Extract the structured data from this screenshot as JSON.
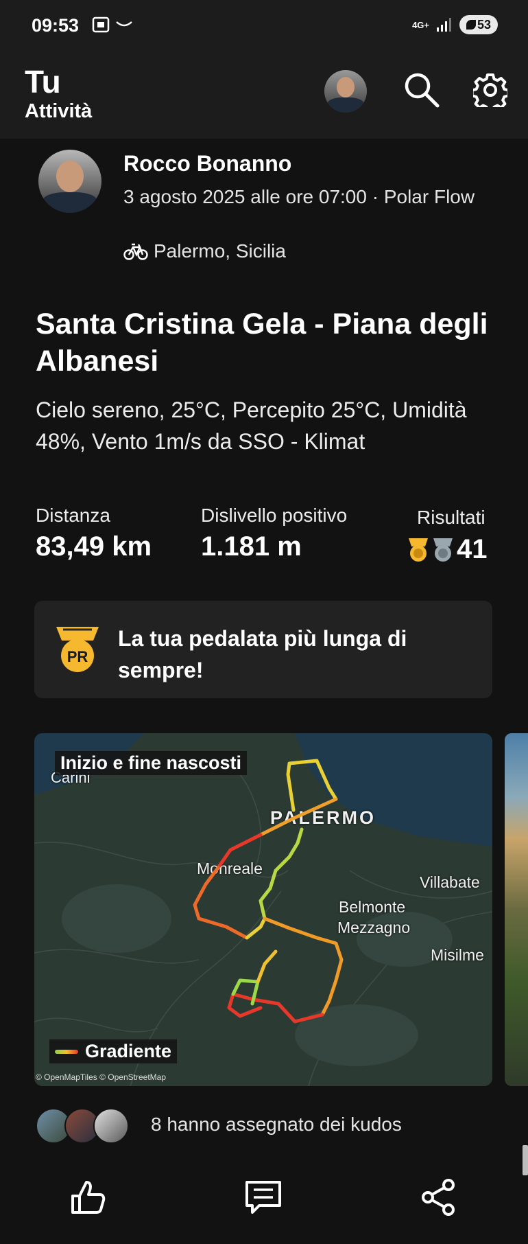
{
  "status_bar": {
    "time": "09:53",
    "network": "4G+",
    "battery": "53"
  },
  "header": {
    "title": "Tu",
    "subtitle": "Attività"
  },
  "activity": {
    "user_name": "Rocco Bonanno",
    "date_source": "3 agosto 2025 alle ore 07:00 · Polar Flow",
    "location": "Palermo, Sicilia",
    "title": "Santa Cristina Gela - Piana degli Albanesi",
    "description": "Cielo sereno, 25°C, Percepito 25°C, Umidità 48%, Vento 1m/s da SSO - Klimat",
    "stats": {
      "distance_label": "Distanza",
      "distance_value": "83,49 km",
      "elevation_label": "Dislivello positivo",
      "elevation_value": "1.181 m",
      "results_label": "Risultati",
      "results_value": "41"
    },
    "pr_card": {
      "text": "La tua pedalata più lunga di sempre!",
      "badge": "PR"
    }
  },
  "map": {
    "badge": "Inizio e fine nascosti",
    "labels": {
      "carini": "Carini",
      "palermo": "PALERMO",
      "monreale": "Monreale",
      "villabate": "Villabate",
      "belmonte": "Belmonte",
      "mezzagno": "Mezzagno",
      "misilmeri": "Misilme"
    },
    "legend": "Gradiente",
    "credits": "© OpenMapTiles © OpenStreetMap",
    "colors": {
      "low": "#8fd14f",
      "mid": "#f0c030",
      "high": "#e8382a",
      "land": "#2c3a34",
      "water": "#1e3a4c"
    }
  },
  "kudos": {
    "text": "8 hanno assegnato dei kudos"
  },
  "actions": {
    "like_icon": "thumbs-up-icon",
    "comment_icon": "comment-icon",
    "share_icon": "share-icon"
  }
}
